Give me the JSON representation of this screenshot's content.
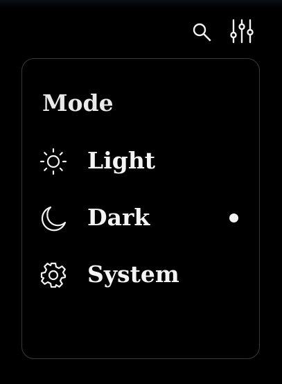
{
  "toolbar": {
    "icons": [
      "search-icon",
      "filter-sliders-icon"
    ]
  },
  "mode_menu": {
    "heading": "Mode",
    "options": [
      {
        "label": "Light",
        "icon": "sun-icon",
        "selected": false
      },
      {
        "label": "Dark",
        "icon": "moon-icon",
        "selected": true
      },
      {
        "label": "System",
        "icon": "gear-icon",
        "selected": false
      }
    ]
  },
  "colors": {
    "background": "#000000",
    "panel_border": "#3a3a3a",
    "text": "#f2f2f2"
  }
}
